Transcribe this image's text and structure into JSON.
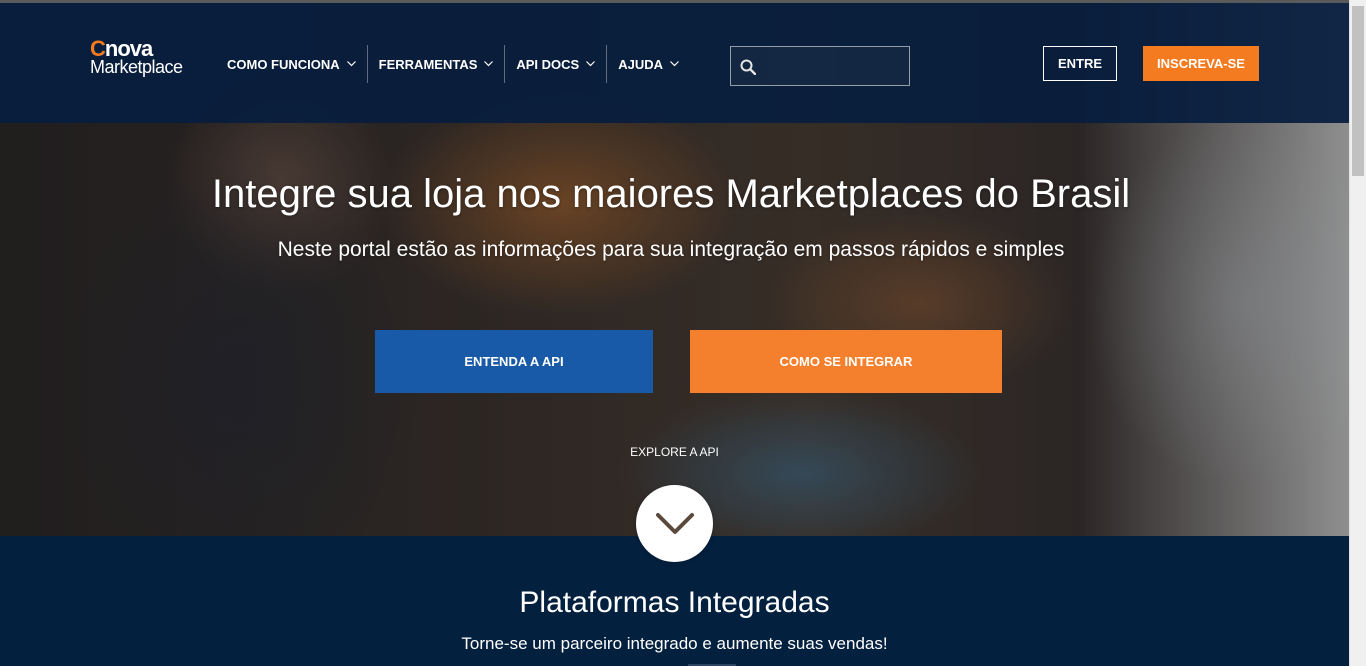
{
  "logo": {
    "top_first_letter": "C",
    "top_rest": "nova",
    "bottom": "Marketplace"
  },
  "nav": {
    "items": [
      {
        "label": "COMO FUNCIONA"
      },
      {
        "label": "FERRAMENTAS"
      },
      {
        "label": "API DOCS"
      },
      {
        "label": "AJUDA"
      }
    ],
    "icons": {
      "dropdown": "chevron-down-icon",
      "search": "search-icon"
    }
  },
  "search": {
    "value": "",
    "placeholder": ""
  },
  "auth": {
    "login_label": "ENTRE",
    "signup_label": "INSCREVA-SE"
  },
  "hero": {
    "title": "Integre sua loja nos maiores Marketplaces do Brasil",
    "subtitle": "Neste portal estão as informações para sua integração em passos rápidos e simples",
    "primary_button": "ENTENDA A API",
    "secondary_button": "COMO SE INTEGRAR",
    "explore_label": "EXPLORE A API",
    "scroll_icon": "chevron-down-icon"
  },
  "platforms": {
    "title": "Plataformas Integradas",
    "subtitle": "Torne-se um parceiro integrado e aumente suas vendas!"
  },
  "colors": {
    "brand_orange": "#f47b20",
    "primary_blue": "#185aa8",
    "header_navy": "#081e3e",
    "section_navy": "#04203f"
  }
}
